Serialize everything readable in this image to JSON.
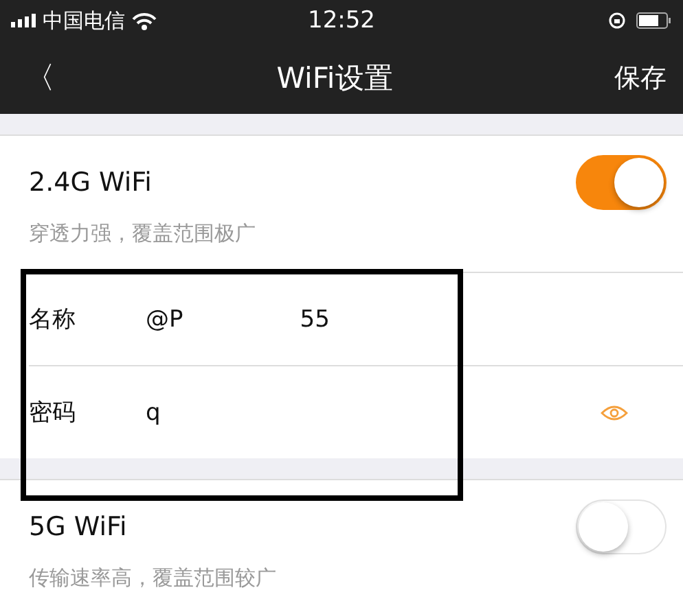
{
  "status_bar": {
    "carrier": "中国电信",
    "time": "12:52"
  },
  "nav": {
    "back": "〈",
    "title": "WiFi设置",
    "action": "保存"
  },
  "bands": [
    {
      "title": "2.4G WiFi",
      "on": true,
      "description": "穿透力强，覆盖范围极广",
      "fields": [
        {
          "kind": "text",
          "label": "名称",
          "value": "@P",
          "value_tail": "55"
        },
        {
          "kind": "password",
          "label": "密码",
          "value": "q"
        }
      ]
    },
    {
      "title": "5G WiFi",
      "on": false,
      "description": "传输速率高，覆盖范围较广"
    }
  ],
  "highlight_frame": {
    "shown": true
  }
}
